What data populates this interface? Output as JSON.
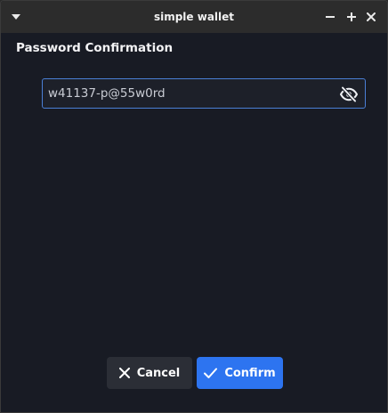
{
  "window": {
    "title": "simple wallet",
    "menu_icon": "caret-down-icon",
    "controls": [
      "minimize-icon",
      "maximize-icon",
      "close-icon"
    ]
  },
  "dialog": {
    "heading": "Password Confirmation",
    "password_value": "w41137-p@55w0rd",
    "toggle_icon": "eye-off-icon"
  },
  "actions": {
    "cancel_label": "Cancel",
    "cancel_icon": "x-icon",
    "confirm_label": "Confirm",
    "confirm_icon": "checkmark-icon"
  },
  "colors": {
    "background": "#181b24",
    "titlebar": "#2c2c2c",
    "accent": "#2d74f0",
    "field_border": "#4a7fd6",
    "cancel_bg": "#2b2e36"
  }
}
